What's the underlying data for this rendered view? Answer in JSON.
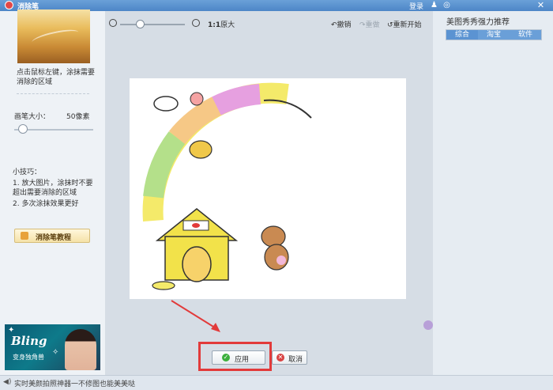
{
  "window": {
    "title": "消除笔",
    "login_label": "登录"
  },
  "left_panel": {
    "tip_description": "点击鼠标左键，涂抹需要消除的区域",
    "brush_size_label": "画笔大小：",
    "brush_size_value": "50像素",
    "brush_size_level": 0.05,
    "tips_title": "小技巧：",
    "tips": [
      "1. 放大图片，涂抹时不要超出需要消除的区域",
      "2. 多次涂抹效果更好"
    ],
    "tutorial_button": "消除笔教程",
    "ad": {
      "title": "Bling",
      "subtitle": "变身独角兽"
    }
  },
  "toolbar": {
    "zoom_level": 0.3,
    "ratio_label": "1:1",
    "fit_label": "原大",
    "undo_label": "撤销",
    "redo_label": "重做",
    "restart_label": "重新开始"
  },
  "actions": {
    "apply_label": "应用",
    "cancel_label": "取消"
  },
  "right_panel": {
    "title": "美图秀秀强力推荐",
    "tabs": [
      "综合",
      "淘宝",
      "软件"
    ],
    "active_tab": "综合"
  },
  "statusbar": {
    "text": "实时美颜拍照神器一不修图也能美美哒"
  },
  "colors": {
    "accent": "#5b93d2",
    "highlight": "#e23a3a",
    "apply_icon": "#3caf3c"
  }
}
